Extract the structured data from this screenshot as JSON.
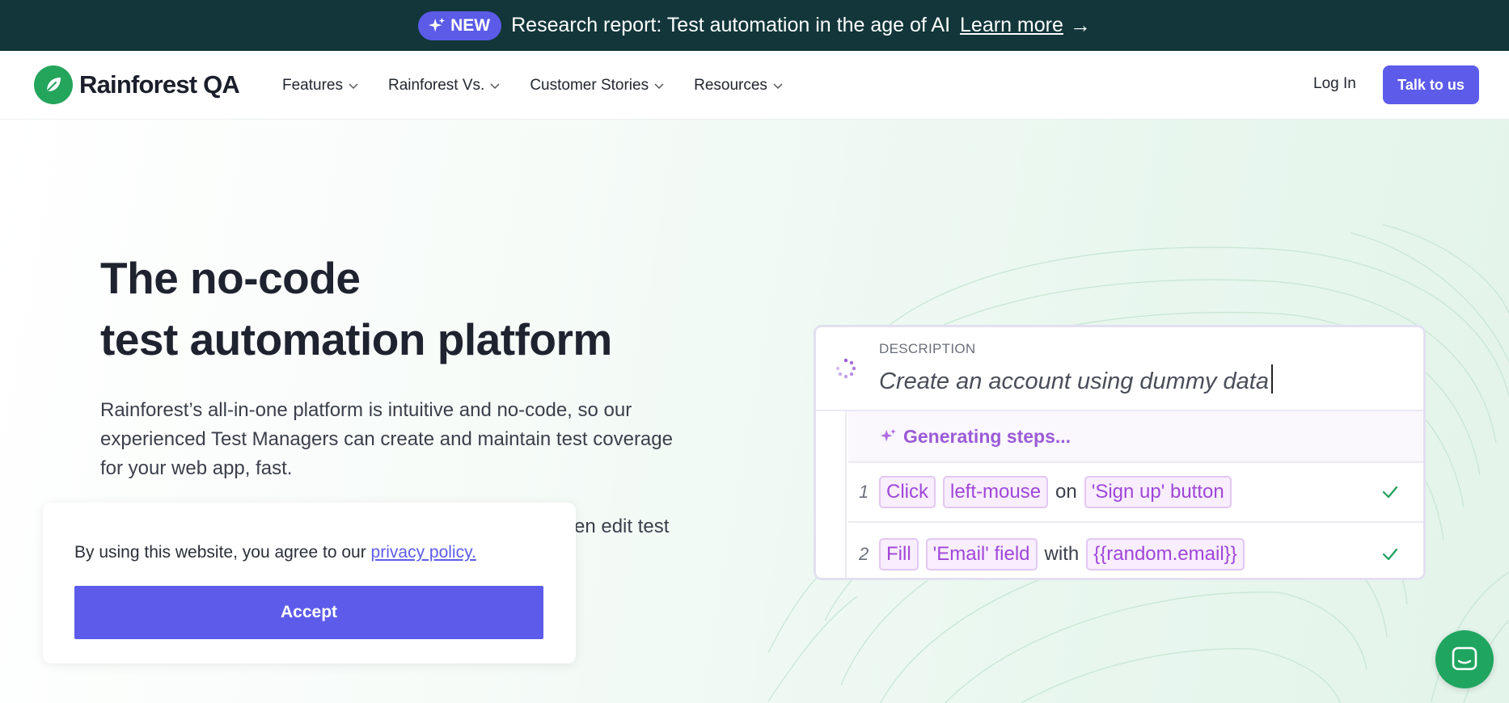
{
  "announcement": {
    "badge": "NEW",
    "text": "Research report: Test automation in the age of AI",
    "link_label": "Learn more",
    "arrow": "→"
  },
  "nav": {
    "brand": "Rainforest QA",
    "items": [
      {
        "label": "Features"
      },
      {
        "label": "Rainforest Vs."
      },
      {
        "label": "Customer Stories"
      },
      {
        "label": "Resources"
      }
    ],
    "login_label": "Log In",
    "cta_label": "Talk to us"
  },
  "hero": {
    "headline_line1": "The no-code",
    "headline_line2": "test automation platform",
    "body": "Rainforest’s all-in-one platform is intuitive and no-code, so our experienced Test Managers can create and maintain test coverage for your web app, fast.",
    "body_partial": "en edit test"
  },
  "demo_card": {
    "label": "DESCRIPTION",
    "description": "Create an account using dummy data",
    "generating": "Generating steps...",
    "steps": [
      {
        "num": "1",
        "action": "Click",
        "arg1": "left-mouse",
        "joiner": "on",
        "arg2": "'Sign up' button"
      },
      {
        "num": "2",
        "action": "Fill",
        "arg1": "'Email' field",
        "joiner": "with",
        "arg2": "{{random.email}}"
      }
    ]
  },
  "cookie": {
    "text": "By using this website, you agree to our",
    "link": "privacy policy.",
    "accept_label": "Accept"
  },
  "icons": {
    "sparkle": "sparkle-icon",
    "chevron": "chevron-down-icon",
    "check": "check-icon",
    "chat": "chat-icon",
    "spinner": "spinner-icon",
    "leaf": "leaf-icon"
  },
  "colors": {
    "announce_bg": "#12363a",
    "brand_green": "#24a55c",
    "accent_purple": "#5d5cea",
    "chip_purple": "#a046d8"
  }
}
